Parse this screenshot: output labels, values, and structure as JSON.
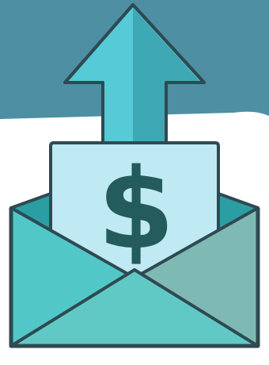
{
  "illustration": {
    "subject": "envelope-with-dollar-upload",
    "dollar_sign": "$"
  },
  "colors": {
    "banner_teal": "#4e8fa3",
    "arrow_light": "#56cad6",
    "arrow_dark": "#3fa8b5",
    "outline": "#2e4a52",
    "card_fill": "#bfe9f3",
    "dollar": "#245b5c",
    "envelope_back": "#2b9ea4",
    "envelope_left": "#52c7c7",
    "envelope_right": "#7fb9b3",
    "envelope_bottom": "#60c9c6",
    "background": "#ffffff"
  }
}
